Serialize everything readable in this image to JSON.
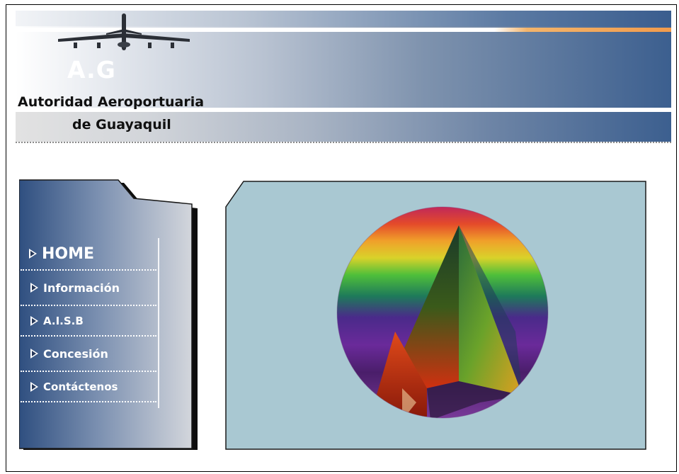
{
  "header": {
    "logo_rest": "A.G",
    "org_line1": "Autoridad Aeroportuaria",
    "org_line2": "de Guayaquil"
  },
  "nav": {
    "items": [
      {
        "label": "HOME"
      },
      {
        "label": "Información"
      },
      {
        "label": "A.I.S.B"
      },
      {
        "label": "Concesión"
      },
      {
        "label": "Contáctenos"
      }
    ]
  },
  "icons": {
    "logo": "airplane-icon",
    "menu_bullet": "triangle-right-icon",
    "hero": "rainbow-pyramid-image"
  },
  "colors": {
    "header_blue": "#3c5f8f",
    "accent_orange": "#f29b4c",
    "panel_bg": "#a9c8d2",
    "sidebar_blue": "#2f4f80"
  }
}
